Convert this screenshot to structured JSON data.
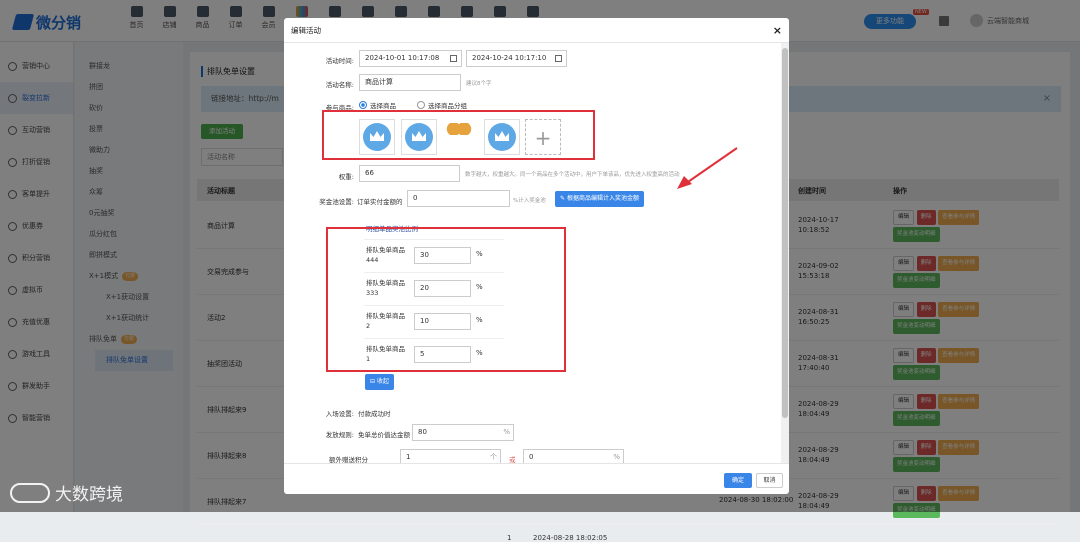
{
  "app": {
    "logo_text": "微分销",
    "nav": [
      "首页",
      "店铺",
      "商品",
      "订单",
      "会员",
      "",
      "",
      "",
      "",
      "",
      "",
      "",
      ""
    ],
    "more_label": "更多功能",
    "new_tag": "NEW",
    "user": "云端智能商城"
  },
  "sidebar": [
    "营销中心",
    "裂变拉新",
    "互动营销",
    "打折促销",
    "客单提升",
    "优惠券",
    "积分营销",
    "虚拟币",
    "充值优惠",
    "游戏工具",
    "群发助手",
    "智能营销"
  ],
  "submenu": [
    {
      "label": "群接龙"
    },
    {
      "label": "拼团"
    },
    {
      "label": "砍价"
    },
    {
      "label": "投票"
    },
    {
      "label": "微助力"
    },
    {
      "label": "抽奖"
    },
    {
      "label": "众筹"
    },
    {
      "label": "0元抽奖"
    },
    {
      "label": "瓜分红包"
    },
    {
      "label": "即拼模式"
    },
    {
      "label": "X+1模式",
      "badge": "付费"
    },
    {
      "label": "X+1获动设置"
    },
    {
      "label": "X+1获动统计"
    },
    {
      "label": "排队免单",
      "badge": "付费"
    },
    {
      "label": "排队免单设置"
    }
  ],
  "page": {
    "title": "排队免单设置",
    "link_label": "链接地址：http://m",
    "add_button": "添加活动",
    "search_placeholder": "活动名称"
  },
  "table": {
    "headers": [
      "活动标题",
      "创建时间",
      "操作"
    ],
    "rows": [
      {
        "title": "商品计算",
        "created": "2024-10-17 10:18:52"
      },
      {
        "title": "交易完成参与",
        "created": "2024-09-02 15:53:18"
      },
      {
        "title": "活动2",
        "created": "2024-08-31 16:50:25"
      },
      {
        "title": "抽奖团活动",
        "created": "2024-08-31 17:40:40"
      },
      {
        "title": "排队排起来9",
        "created": "2024-08-29 18:04:49"
      },
      {
        "title": "排队排起来8",
        "created": "2024-08-29 18:04:49"
      },
      {
        "title": "排队排起来7",
        "created": "2024-08-29 18:04:49"
      }
    ],
    "ops": {
      "edit": "编辑",
      "delete": "删除",
      "view": "查看参与详情",
      "pool": "奖金池变动明细"
    },
    "extra": {
      "count": "1",
      "start": "2024-08-28 18:02:05",
      "end": "2024-08-30 18:02:00"
    }
  },
  "modal": {
    "title": "编辑活动",
    "close": "×",
    "time_label": "活动时间:",
    "start_time": "2024-10-01 10:17:08",
    "end_time": "2024-10-24 10:17:10",
    "name_label": "活动名称:",
    "name_value": "商品计算",
    "name_hint": "建议8个字",
    "products_label": "参与商品:",
    "radio_products": "选择商品",
    "radio_group": "选择商品分组",
    "weight_label": "权重:",
    "weight_value": "66",
    "weight_hint": "数字越大，权重越大。同一个商品在多个活动中，用户下单该品，优先进入权重高的活动",
    "pool_label": "奖金池设置:",
    "pool_sub": "订单实付金额的",
    "pool_value": "0",
    "pool_suffix": "%计入奖金池",
    "pool_button": "根据商品编辑计入奖池金额",
    "ratio_title": "明细单品奖池比例",
    "ratios": [
      {
        "name": "排队免单商品444",
        "value": "30"
      },
      {
        "name": "排队免单商品333",
        "value": "20"
      },
      {
        "name": "排队免单商品2",
        "value": "10"
      },
      {
        "name": "排队免单商品1",
        "value": "5"
      }
    ],
    "percent": "%",
    "collapse": "收起",
    "entry_label": "入场设置:",
    "entry_value": "付款成功时",
    "rule_label": "发放规则:",
    "rule_sub": "免单总价值达金额",
    "rule_value": "80",
    "rule_pct": "%",
    "extra_label": "额外赠送积分",
    "extra_value": "1",
    "or_label": "或",
    "extra_value2": "0",
    "ok": "确定",
    "cancel": "取消"
  },
  "watermark": "大数跨境"
}
